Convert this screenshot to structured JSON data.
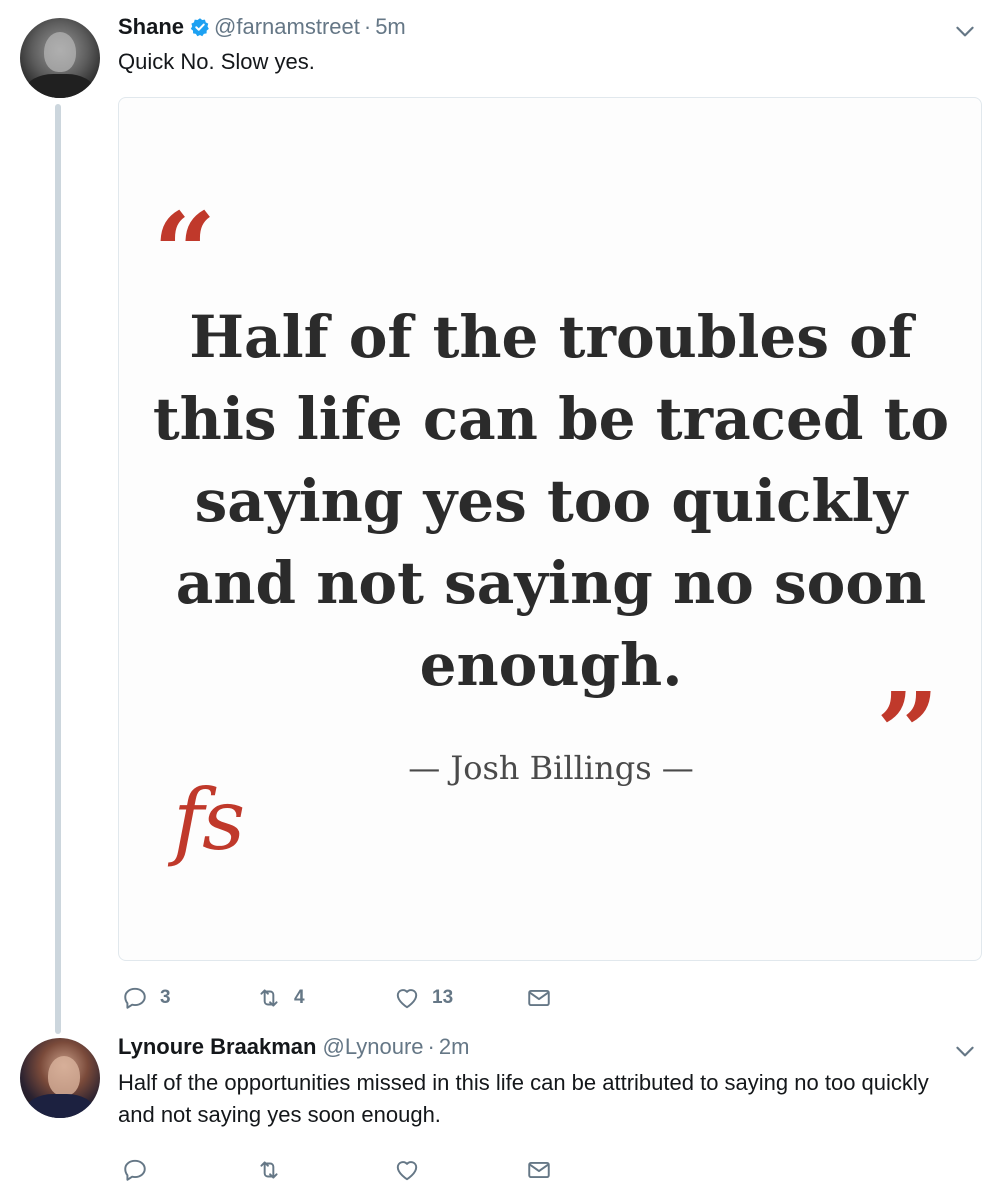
{
  "tweets": [
    {
      "author_name": "Shane",
      "verified": true,
      "handle": "@farnamstreet",
      "separator": "·",
      "time": "5m",
      "text": "Quick No. Slow yes.",
      "media": {
        "quote_open": "“",
        "quote": "Half of the troubles of this life can be traced to saying yes too quickly and not saying no soon enough.",
        "quote_close": "”",
        "author": "— Josh Billings —",
        "brand": "fs",
        "accent_color": "#c0392b"
      },
      "actions": {
        "replies": "3",
        "retweets": "4",
        "likes": "13"
      }
    },
    {
      "author_name": "Lynoure Braakman",
      "verified": false,
      "handle": "@Lynoure",
      "separator": "·",
      "time": "2m",
      "text": "Half of the opportunities missed in this life can be attributed to saying no too quickly and not saying yes soon enough.",
      "actions": {
        "replies": "",
        "retweets": "",
        "likes": ""
      }
    }
  ],
  "icons": {
    "verified": "verified-badge-icon",
    "caret": "chevron-down-icon",
    "reply": "reply-icon",
    "retweet": "retweet-icon",
    "like": "heart-icon",
    "dm": "envelope-icon"
  },
  "colors": {
    "text_primary": "#14171a",
    "text_secondary": "#657786",
    "verified_blue": "#1da1f2",
    "thread_line": "#ccd6dd",
    "card_border": "#e1e8ed"
  }
}
